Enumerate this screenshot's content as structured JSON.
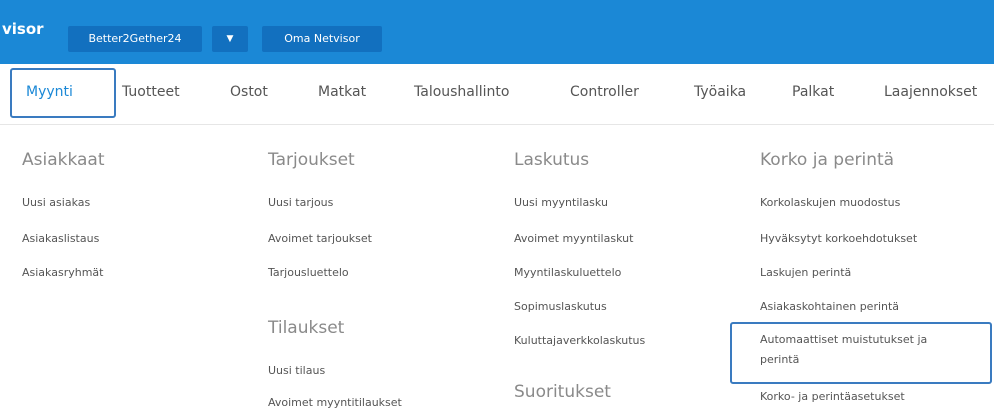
{
  "topbar": {
    "brand": "visor",
    "company": "Better2Gether24",
    "dropdown_icon": "▼",
    "own_label": "Oma Netvisor"
  },
  "nav": {
    "items": [
      "Myynti",
      "Tuotteet",
      "Ostot",
      "Matkat",
      "Taloushallinto",
      "Controller",
      "Työaika",
      "Palkat",
      "Laajennokset"
    ],
    "active": "Myynti"
  },
  "menu": {
    "asiakkaat": {
      "title": "Asiakkaat",
      "links": [
        "Uusi asiakas",
        "Asiakaslistaus",
        "Asiakasryhmät"
      ]
    },
    "tarjoukset": {
      "title": "Tarjoukset",
      "links": [
        "Uusi tarjous",
        "Avoimet tarjoukset",
        "Tarjousluettelo"
      ]
    },
    "tilaukset": {
      "title": "Tilaukset",
      "links": [
        "Uusi tilaus",
        "Avoimet myyntitilaukset"
      ]
    },
    "laskutus": {
      "title": "Laskutus",
      "links": [
        "Uusi myyntilasku",
        "Avoimet myyntilaskut",
        "Myyntilaskuluettelo",
        "Sopimuslaskutus",
        "Kuluttajaverkkolaskutus"
      ]
    },
    "suoritukset": {
      "title": "Suoritukset"
    },
    "korko": {
      "title": "Korko ja perintä",
      "links": [
        "Korkolaskujen muodostus",
        "Hyväksytyt korkoehdotukset",
        "Laskujen perintä",
        "Asiakaskohtainen perintä",
        "Automaattiset muistutukset ja perintä",
        "Korko- ja perintäasetukset"
      ]
    }
  }
}
